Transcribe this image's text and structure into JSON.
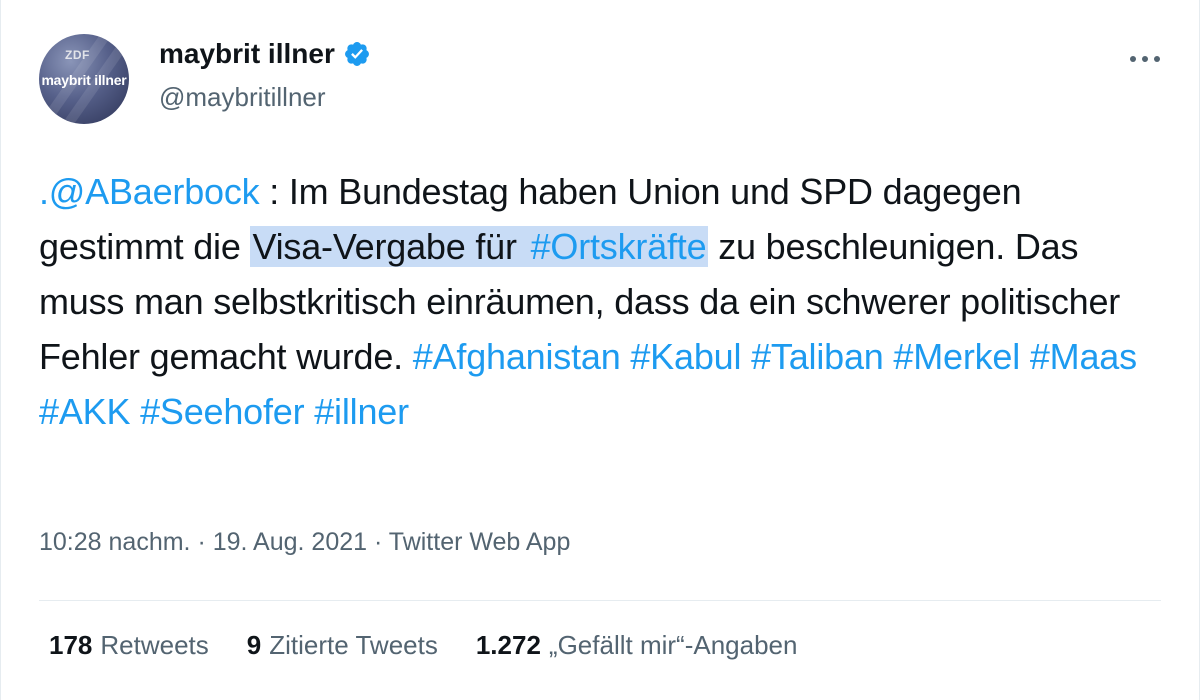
{
  "author": {
    "display_name": "maybrit illner",
    "handle": "@maybritillner",
    "avatar_text": "maybrit illner",
    "avatar_brand": "ZDF",
    "verified": true
  },
  "tweet": {
    "mention": ".@ABaerbock",
    "text_1": " : Im Bundestag haben Union und SPD dagegen gestimmt die ",
    "highlighted_text": "Visa-Vergabe für ",
    "highlighted_hashtag": "#Ortskräfte",
    "text_2": " zu beschleunigen. Das muss man selbstkritisch einräumen, dass da ein schwerer politischer Fehler gemacht wurde. ",
    "hashtags": [
      "#Afghanistan",
      "#Kabul",
      "#Taliban",
      "#Merkel",
      "#Maas",
      "#AKK",
      "#Seehofer",
      "#illner"
    ]
  },
  "meta": {
    "time": "10:28 nachm.",
    "date": "19. Aug. 2021",
    "source": "Twitter Web App",
    "separator": " · "
  },
  "stats": {
    "retweets": {
      "count": "178",
      "label": "Retweets"
    },
    "quotes": {
      "count": "9",
      "label": "Zitierte Tweets"
    },
    "likes": {
      "count": "1.272",
      "label": "„Gefällt mir“-Angaben"
    }
  },
  "colors": {
    "link": "#1d9bf0",
    "highlight": "#c8dcf6",
    "secondary_text": "#536471",
    "verified_badge": "#1d9bf0"
  },
  "icons": {
    "verified": "verified-badge-icon",
    "more": "more-dots-icon"
  }
}
